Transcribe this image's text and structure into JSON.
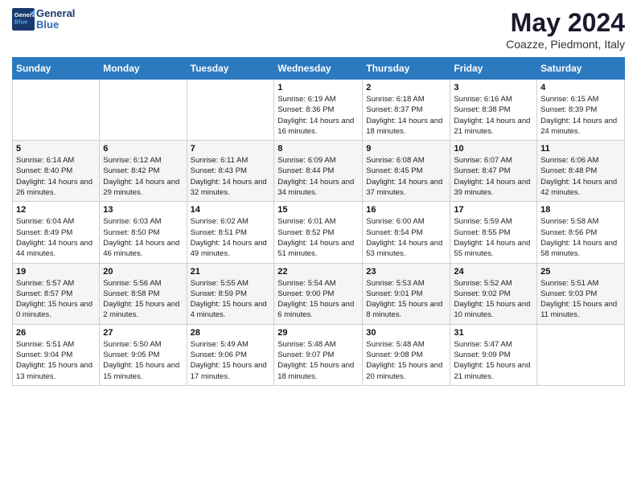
{
  "header": {
    "logo_line1": "General",
    "logo_line2": "Blue",
    "month_title": "May 2024",
    "subtitle": "Coazze, Piedmont, Italy"
  },
  "days_of_week": [
    "Sunday",
    "Monday",
    "Tuesday",
    "Wednesday",
    "Thursday",
    "Friday",
    "Saturday"
  ],
  "weeks": [
    {
      "days": [
        {
          "number": "",
          "sunrise": "",
          "sunset": "",
          "daylight": ""
        },
        {
          "number": "",
          "sunrise": "",
          "sunset": "",
          "daylight": ""
        },
        {
          "number": "",
          "sunrise": "",
          "sunset": "",
          "daylight": ""
        },
        {
          "number": "1",
          "sunrise": "Sunrise: 6:19 AM",
          "sunset": "Sunset: 8:36 PM",
          "daylight": "Daylight: 14 hours and 16 minutes."
        },
        {
          "number": "2",
          "sunrise": "Sunrise: 6:18 AM",
          "sunset": "Sunset: 8:37 PM",
          "daylight": "Daylight: 14 hours and 18 minutes."
        },
        {
          "number": "3",
          "sunrise": "Sunrise: 6:16 AM",
          "sunset": "Sunset: 8:38 PM",
          "daylight": "Daylight: 14 hours and 21 minutes."
        },
        {
          "number": "4",
          "sunrise": "Sunrise: 6:15 AM",
          "sunset": "Sunset: 8:39 PM",
          "daylight": "Daylight: 14 hours and 24 minutes."
        }
      ]
    },
    {
      "days": [
        {
          "number": "5",
          "sunrise": "Sunrise: 6:14 AM",
          "sunset": "Sunset: 8:40 PM",
          "daylight": "Daylight: 14 hours and 26 minutes."
        },
        {
          "number": "6",
          "sunrise": "Sunrise: 6:12 AM",
          "sunset": "Sunset: 8:42 PM",
          "daylight": "Daylight: 14 hours and 29 minutes."
        },
        {
          "number": "7",
          "sunrise": "Sunrise: 6:11 AM",
          "sunset": "Sunset: 8:43 PM",
          "daylight": "Daylight: 14 hours and 32 minutes."
        },
        {
          "number": "8",
          "sunrise": "Sunrise: 6:09 AM",
          "sunset": "Sunset: 8:44 PM",
          "daylight": "Daylight: 14 hours and 34 minutes."
        },
        {
          "number": "9",
          "sunrise": "Sunrise: 6:08 AM",
          "sunset": "Sunset: 8:45 PM",
          "daylight": "Daylight: 14 hours and 37 minutes."
        },
        {
          "number": "10",
          "sunrise": "Sunrise: 6:07 AM",
          "sunset": "Sunset: 8:47 PM",
          "daylight": "Daylight: 14 hours and 39 minutes."
        },
        {
          "number": "11",
          "sunrise": "Sunrise: 6:06 AM",
          "sunset": "Sunset: 8:48 PM",
          "daylight": "Daylight: 14 hours and 42 minutes."
        }
      ]
    },
    {
      "days": [
        {
          "number": "12",
          "sunrise": "Sunrise: 6:04 AM",
          "sunset": "Sunset: 8:49 PM",
          "daylight": "Daylight: 14 hours and 44 minutes."
        },
        {
          "number": "13",
          "sunrise": "Sunrise: 6:03 AM",
          "sunset": "Sunset: 8:50 PM",
          "daylight": "Daylight: 14 hours and 46 minutes."
        },
        {
          "number": "14",
          "sunrise": "Sunrise: 6:02 AM",
          "sunset": "Sunset: 8:51 PM",
          "daylight": "Daylight: 14 hours and 49 minutes."
        },
        {
          "number": "15",
          "sunrise": "Sunrise: 6:01 AM",
          "sunset": "Sunset: 8:52 PM",
          "daylight": "Daylight: 14 hours and 51 minutes."
        },
        {
          "number": "16",
          "sunrise": "Sunrise: 6:00 AM",
          "sunset": "Sunset: 8:54 PM",
          "daylight": "Daylight: 14 hours and 53 minutes."
        },
        {
          "number": "17",
          "sunrise": "Sunrise: 5:59 AM",
          "sunset": "Sunset: 8:55 PM",
          "daylight": "Daylight: 14 hours and 55 minutes."
        },
        {
          "number": "18",
          "sunrise": "Sunrise: 5:58 AM",
          "sunset": "Sunset: 8:56 PM",
          "daylight": "Daylight: 14 hours and 58 minutes."
        }
      ]
    },
    {
      "days": [
        {
          "number": "19",
          "sunrise": "Sunrise: 5:57 AM",
          "sunset": "Sunset: 8:57 PM",
          "daylight": "Daylight: 15 hours and 0 minutes."
        },
        {
          "number": "20",
          "sunrise": "Sunrise: 5:56 AM",
          "sunset": "Sunset: 8:58 PM",
          "daylight": "Daylight: 15 hours and 2 minutes."
        },
        {
          "number": "21",
          "sunrise": "Sunrise: 5:55 AM",
          "sunset": "Sunset: 8:59 PM",
          "daylight": "Daylight: 15 hours and 4 minutes."
        },
        {
          "number": "22",
          "sunrise": "Sunrise: 5:54 AM",
          "sunset": "Sunset: 9:00 PM",
          "daylight": "Daylight: 15 hours and 6 minutes."
        },
        {
          "number": "23",
          "sunrise": "Sunrise: 5:53 AM",
          "sunset": "Sunset: 9:01 PM",
          "daylight": "Daylight: 15 hours and 8 minutes."
        },
        {
          "number": "24",
          "sunrise": "Sunrise: 5:52 AM",
          "sunset": "Sunset: 9:02 PM",
          "daylight": "Daylight: 15 hours and 10 minutes."
        },
        {
          "number": "25",
          "sunrise": "Sunrise: 5:51 AM",
          "sunset": "Sunset: 9:03 PM",
          "daylight": "Daylight: 15 hours and 11 minutes."
        }
      ]
    },
    {
      "days": [
        {
          "number": "26",
          "sunrise": "Sunrise: 5:51 AM",
          "sunset": "Sunset: 9:04 PM",
          "daylight": "Daylight: 15 hours and 13 minutes."
        },
        {
          "number": "27",
          "sunrise": "Sunrise: 5:50 AM",
          "sunset": "Sunset: 9:05 PM",
          "daylight": "Daylight: 15 hours and 15 minutes."
        },
        {
          "number": "28",
          "sunrise": "Sunrise: 5:49 AM",
          "sunset": "Sunset: 9:06 PM",
          "daylight": "Daylight: 15 hours and 17 minutes."
        },
        {
          "number": "29",
          "sunrise": "Sunrise: 5:48 AM",
          "sunset": "Sunset: 9:07 PM",
          "daylight": "Daylight: 15 hours and 18 minutes."
        },
        {
          "number": "30",
          "sunrise": "Sunrise: 5:48 AM",
          "sunset": "Sunset: 9:08 PM",
          "daylight": "Daylight: 15 hours and 20 minutes."
        },
        {
          "number": "31",
          "sunrise": "Sunrise: 5:47 AM",
          "sunset": "Sunset: 9:09 PM",
          "daylight": "Daylight: 15 hours and 21 minutes."
        },
        {
          "number": "",
          "sunrise": "",
          "sunset": "",
          "daylight": ""
        }
      ]
    }
  ]
}
